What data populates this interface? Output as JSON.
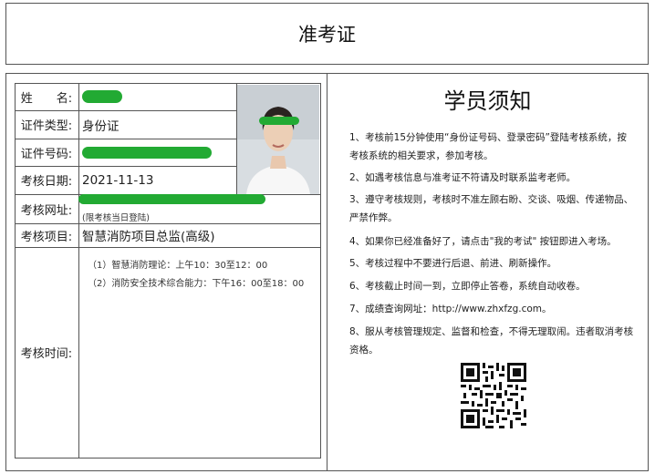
{
  "title": "准考证",
  "form": {
    "name_label": "姓　　名:",
    "id_type_label": "证件类型:",
    "id_type_value": "身份证",
    "id_number_label": "证件号码:",
    "exam_date_label": "考核日期:",
    "exam_date_value": "2021-11-13",
    "exam_url_label": "考核网址:",
    "exam_url_note": "(限考核当日登陆)",
    "exam_project_label": "考核项目:",
    "exam_project_value": "智慧消防项目总监(高级)",
    "exam_time_label": "考核时间:",
    "schedule": [
      "（1）智慧消防理论：上午10：30至12：00",
      "（2）消防安全技术综合能力：下午16：00至18：00"
    ]
  },
  "rules": {
    "title": "学员须知",
    "items": [
      "1、考核前15分钟使用“身份证号码、登录密码”登陆考核系统，按考核系统的相关要求，参加考核。",
      "2、如遇考核信息与准考证不符请及时联系监考老师。",
      "3、遵守考核规则，考核时不准左顾右盼、交谈、吸烟、传递物品、严禁作弊。",
      "4、如果你已经准备好了，请点击\"我的考试\" 按钮即进入考场。",
      "5、考核过程中不要进行后退、前进、刷新操作。",
      "6、考核截止时间一到，立即停止答卷，系统自动收卷。",
      "7、成绩查询网址：http://www.zhxfzg.com。",
      "8、服从考核管理规定、监督和检查，不得无理取闹。违者取消考核资格。"
    ]
  },
  "colors": {
    "redaction": "#22aa33",
    "border": "#555555"
  }
}
